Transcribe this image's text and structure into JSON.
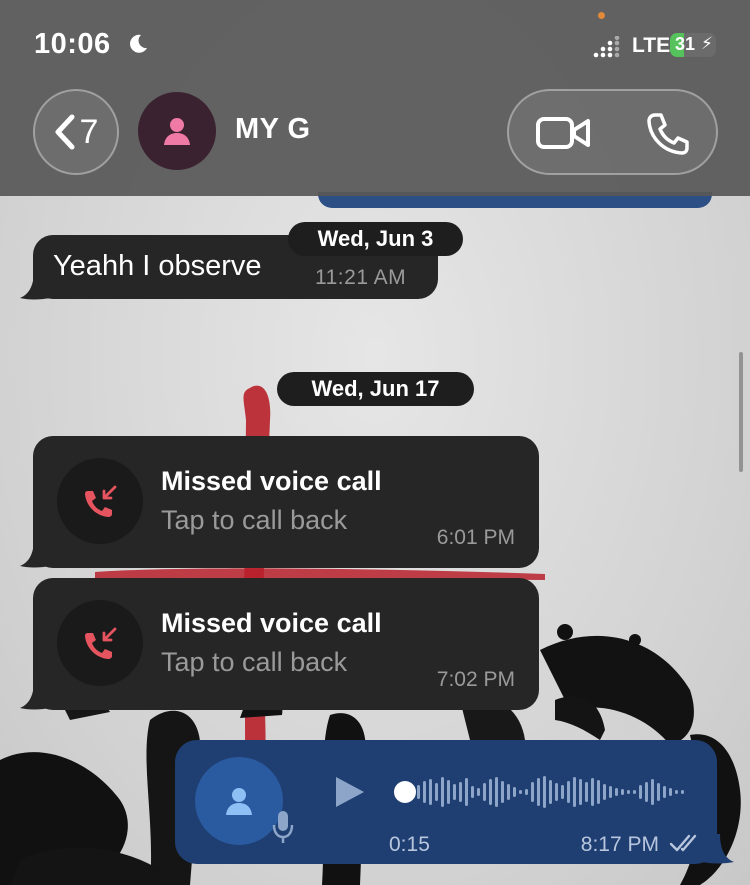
{
  "status_bar": {
    "time": "10:06",
    "network": "LTE",
    "battery": "31",
    "battery_level": 0.31
  },
  "header": {
    "back_count": "7",
    "contact_name": "MY G",
    "icons": [
      "back-chevron-icon",
      "person-icon",
      "video-call-icon",
      "phone-icon"
    ]
  },
  "messages": [
    {
      "date": "Wed, Jun 3"
    },
    {
      "text": "Yeahh I observe",
      "time": "11:21 AM"
    },
    {
      "date": "Wed, Jun 17"
    },
    {
      "title": "Missed voice call",
      "subtitle": "Tap to call back",
      "time": "6:01 PM"
    },
    {
      "title": "Missed voice call",
      "subtitle": "Tap to call back",
      "time": "7:02 PM"
    },
    {
      "duration": "0:15",
      "time": "8:17 PM",
      "progress": 0
    }
  ],
  "colors": {
    "header_bg": "#585858",
    "incoming_bubble": "#262626",
    "outgoing_bubble": "#1f3f73",
    "missed_call_red": "#e5545f",
    "battery_green": "#55c25c"
  }
}
